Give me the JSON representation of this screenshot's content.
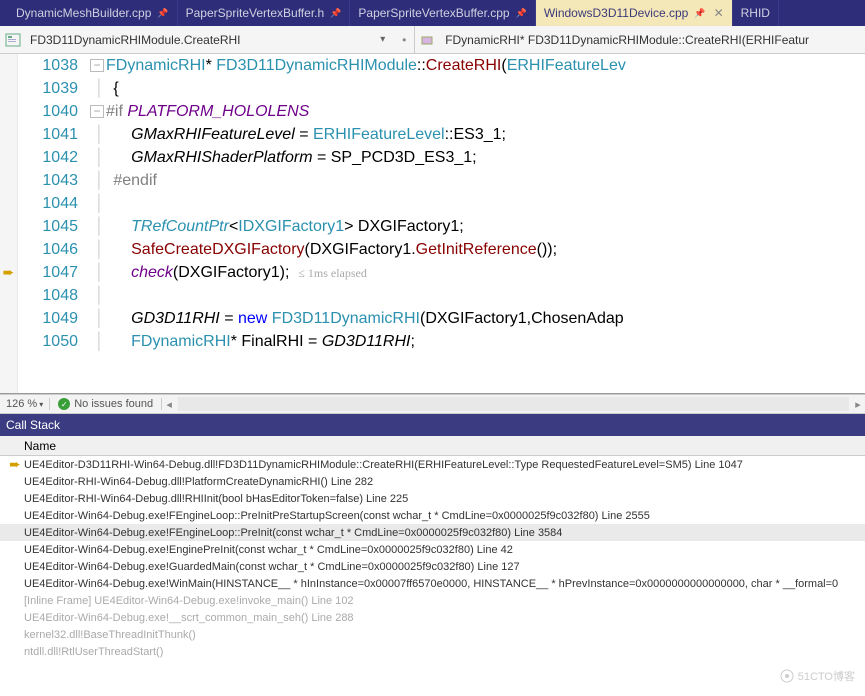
{
  "tabs": [
    {
      "label": "DynamicMeshBuilder.cpp",
      "pinned": true,
      "active": false
    },
    {
      "label": "PaperSpriteVertexBuffer.h",
      "pinned": true,
      "active": false
    },
    {
      "label": "PaperSpriteVertexBuffer.cpp",
      "pinned": true,
      "active": false
    },
    {
      "label": "WindowsD3D11Device.cpp",
      "pinned": true,
      "active": true
    },
    {
      "label": "RHID",
      "pinned": false,
      "active": false,
      "extra": true
    }
  ],
  "nav": {
    "left": "FD3D11DynamicRHIModule.CreateRHI",
    "right": "FDynamicRHI* FD3D11DynamicRHIModule::CreateRHI(ERHIFeatur"
  },
  "editor": {
    "current_line_marker": 1047,
    "lines": [
      {
        "num": 1038,
        "collapse": "-",
        "pre": "",
        "tokens": [
          [
            "k-type",
            "FDynamicRHI"
          ],
          [
            "",
            "* "
          ],
          [
            "k-type",
            "FD3D11DynamicRHIModule"
          ],
          [
            "",
            "::"
          ],
          [
            "k-id",
            "CreateRHI"
          ],
          [
            "",
            "("
          ],
          [
            "k-type",
            "ERHIFeatureLev"
          ]
        ]
      },
      {
        "num": 1039,
        "pre": "  ",
        "tokens": [
          [
            "",
            "{"
          ]
        ]
      },
      {
        "num": 1040,
        "collapse": "-",
        "pre": "",
        "tokens": [
          [
            "k-pp",
            "#if "
          ],
          [
            "k-mac",
            "PLATFORM_HOLOLENS"
          ]
        ]
      },
      {
        "num": 1041,
        "pre": "      ",
        "tokens": [
          [
            "k-ital",
            "GMaxRHIFeatureLevel"
          ],
          [
            "",
            " = "
          ],
          [
            "k-type",
            "ERHIFeatureLevel"
          ],
          [
            "",
            "::ES3_1;"
          ]
        ]
      },
      {
        "num": 1042,
        "pre": "      ",
        "tokens": [
          [
            "k-ital",
            "GMaxRHIShaderPlatform"
          ],
          [
            "",
            " = SP_PCD3D_ES3_1;"
          ]
        ]
      },
      {
        "num": 1043,
        "pre": "  ",
        "tokens": [
          [
            "k-pp",
            "#endif"
          ]
        ]
      },
      {
        "num": 1044,
        "pre": "",
        "tokens": []
      },
      {
        "num": 1045,
        "pre": "      ",
        "tokens": [
          [
            "k-type k-ital",
            "TRefCountPtr"
          ],
          [
            "",
            "<"
          ],
          [
            "k-type",
            "IDXGIFactory1"
          ],
          [
            "",
            "> DXGIFactory1;"
          ]
        ]
      },
      {
        "num": 1046,
        "pre": "      ",
        "tokens": [
          [
            "k-id",
            "SafeCreateDXGIFactory"
          ],
          [
            "",
            "(DXGIFactory1."
          ],
          [
            "k-id",
            "GetInitReference"
          ],
          [
            "",
            "());"
          ]
        ]
      },
      {
        "num": 1047,
        "mark": "arrow",
        "pre": "      ",
        "tokens": [
          [
            "k-mac",
            "check"
          ],
          [
            "",
            "(DXGIFactory1);  "
          ],
          [
            "hint",
            "≤ 1ms elapsed"
          ]
        ]
      },
      {
        "num": 1048,
        "pre": "",
        "tokens": []
      },
      {
        "num": 1049,
        "pre": "      ",
        "tokens": [
          [
            "k-ital",
            "GD3D11RHI"
          ],
          [
            "",
            " = "
          ],
          [
            "k-kw",
            "new"
          ],
          [
            "",
            " "
          ],
          [
            "k-type",
            "FD3D11DynamicRHI"
          ],
          [
            "",
            "(DXGIFactory1,ChosenAdap"
          ]
        ]
      },
      {
        "num": 1050,
        "pre": "      ",
        "tokens": [
          [
            "k-type",
            "FDynamicRHI"
          ],
          [
            "",
            "* FinalRHI = "
          ],
          [
            "k-ital",
            "GD3D11RHI"
          ],
          [
            "",
            ";"
          ]
        ]
      }
    ]
  },
  "status": {
    "zoom": "126 %",
    "issues": "No issues found"
  },
  "call_stack": {
    "title": "Call Stack",
    "header": "Name",
    "frames": [
      {
        "mark": "arrow",
        "text": "UE4Editor-D3D11RHI-Win64-Debug.dll!FD3D11DynamicRHIModule::CreateRHI(ERHIFeatureLevel::Type RequestedFeatureLevel=SM5) Line 1047"
      },
      {
        "text": "UE4Editor-RHI-Win64-Debug.dll!PlatformCreateDynamicRHI() Line 282"
      },
      {
        "text": "UE4Editor-RHI-Win64-Debug.dll!RHIInit(bool bHasEditorToken=false) Line 225"
      },
      {
        "text": "UE4Editor-Win64-Debug.exe!FEngineLoop::PreInitPreStartupScreen(const wchar_t * CmdLine=0x0000025f9c032f80) Line 2555"
      },
      {
        "hl": true,
        "text": "UE4Editor-Win64-Debug.exe!FEngineLoop::PreInit(const wchar_t * CmdLine=0x0000025f9c032f80) Line 3584"
      },
      {
        "text": "UE4Editor-Win64-Debug.exe!EnginePreInit(const wchar_t * CmdLine=0x0000025f9c032f80) Line 42"
      },
      {
        "text": "UE4Editor-Win64-Debug.exe!GuardedMain(const wchar_t * CmdLine=0x0000025f9c032f80) Line 127"
      },
      {
        "text": "UE4Editor-Win64-Debug.exe!WinMain(HINSTANCE__ * hInInstance=0x00007ff6570e0000, HINSTANCE__ * hPrevInstance=0x0000000000000000, char * __formal=0"
      },
      {
        "grey": true,
        "text": "[Inline Frame] UE4Editor-Win64-Debug.exe!invoke_main() Line 102"
      },
      {
        "grey": true,
        "text": "UE4Editor-Win64-Debug.exe!__scrt_common_main_seh() Line 288"
      },
      {
        "grey": true,
        "text": "kernel32.dll!BaseThreadInitThunk()"
      },
      {
        "grey": true,
        "text": "ntdll.dll!RtlUserThreadStart()"
      }
    ]
  },
  "watermark": "51CTO博客"
}
